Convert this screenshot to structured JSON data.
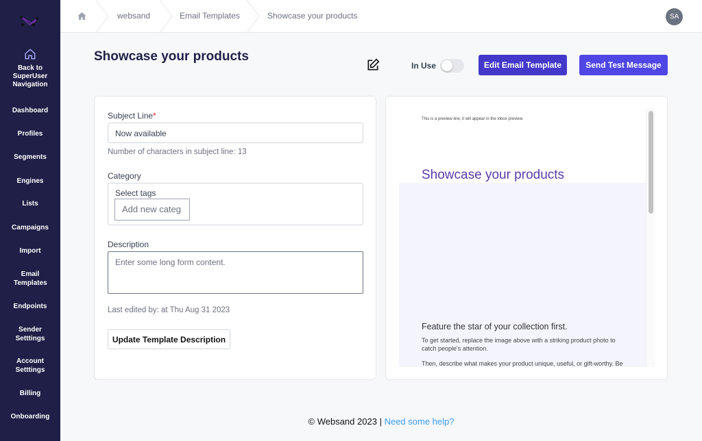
{
  "sidebar": {
    "back": "Back to SuperUser Navigation",
    "items": [
      "Dashboard",
      "Profiles",
      "Segments",
      "Engines",
      "Lists",
      "Campaigns",
      "Import",
      "Email Templates",
      "Endpoints",
      "Sender Setttings",
      "Account Setttings",
      "Billing",
      "Onboarding"
    ]
  },
  "breadcrumb": [
    "websand",
    "Email Templates",
    "Showcase your products"
  ],
  "user": {
    "initials": "SA"
  },
  "header": {
    "title": "Showcase your products",
    "in_use_label": "In Use",
    "in_use": false,
    "edit_label": "Edit Email Template",
    "send_label": "Send Test Message"
  },
  "form": {
    "subject_label": "Subject Line",
    "required_mark": "*",
    "subject_value": "Now available",
    "char_count": "Number of characters in subject line: 13",
    "category_label": "Category",
    "tags_label": "Select tags",
    "tags_placeholder": "Add new categ",
    "description_label": "Description",
    "description_placeholder": "Enter some long form content.",
    "last_edited": "Last edited by: at Thu Aug 31 2023",
    "update_label": "Update Template Description"
  },
  "preview": {
    "preview_line": "This is a preview line, it will appear in the inbox preview.",
    "title": "Showcase your products",
    "heading": "Feature the star of your collection first.",
    "p1": "To get started, replace the image above with a striking product photo to catch people's attention.",
    "p2": "Then, describe what makes your product unique, useful, or gift-worthy. Be"
  },
  "footer": {
    "copyright": "© Websand 2023",
    "separator": "|",
    "help": "Need some help?"
  },
  "colors": {
    "sidebar": "#1f1f47",
    "edit_button": "#4338ca",
    "send_button": "#4f46e5",
    "preview_title": "#5b3aa8",
    "link": "#3b9bf0"
  }
}
